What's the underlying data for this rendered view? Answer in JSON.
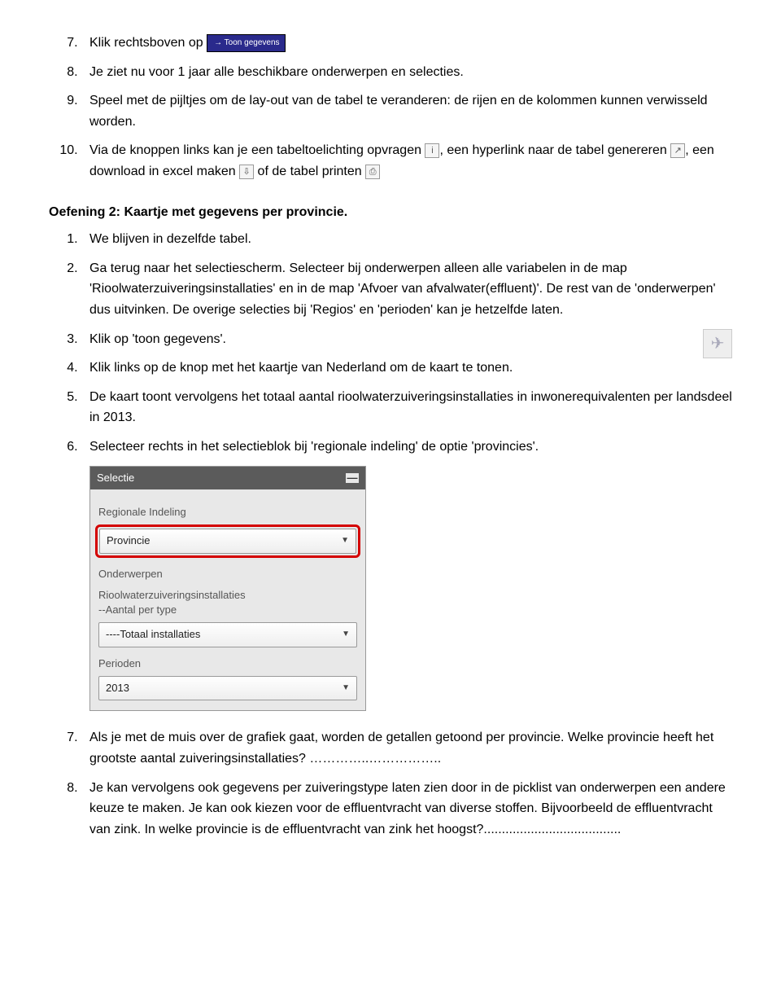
{
  "items_a": {
    "i7_pre": "Klik rechtsboven op ",
    "i7_btn": "→ Toon gegevens",
    "i8": "Je ziet nu voor 1 jaar alle beschikbare onderwerpen en selecties.",
    "i9": "Speel met de pijltjes om de lay-out van de tabel te veranderen: de rijen en de kolommen kunnen verwisseld worden.",
    "i10_a": "Via de knoppen links kan je een tabeltoelichting opvragen ",
    "i10_b": ", een hyperlink naar de tabel genereren ",
    "i10_c": ", een download in excel maken ",
    "i10_d": " of de tabel printen "
  },
  "heading": "Oefening 2: Kaartje met gegevens per provincie.",
  "items_b": {
    "i1": "We blijven in dezelfde tabel.",
    "i2": "Ga terug naar het selectiescherm. Selecteer bij onderwerpen alleen alle variabelen in de map 'Rioolwaterzuiveringsinstallaties' en in de map 'Afvoer van afvalwater(effluent)'. De rest van de 'onderwerpen' dus uitvinken. De overige selecties bij 'Regios' en 'perioden' kan je hetzelfde laten.",
    "i3": "Klik op 'toon gegevens'.",
    "i4": "Klik links op de knop met het kaartje van Nederland om de kaart te tonen.",
    "i5": "De kaart toont vervolgens het totaal aantal rioolwaterzuiveringsinstallaties in inwonerequivalenten per landsdeel in 2013.",
    "i6": "Selecteer rechts in het selectieblok bij 'regionale indeling' de optie 'provincies'.",
    "i7": "Als je met de muis over de grafiek gaat, worden de getallen getoond per provincie. Welke provincie heeft het grootste aantal zuiveringsinstallaties? …………..……………..",
    "i8": "Je kan vervolgens ook gegevens per zuiveringstype laten zien door in de picklist van onderwerpen een andere keuze te maken. Je kan ook kiezen voor de effluentvracht van diverse stoffen. Bijvoorbeeld de effluentvracht van zink. In welke provincie is de effluentvracht van zink het hoogst?......................................"
  },
  "panel": {
    "title": "Selectie",
    "label1": "Regionale Indeling",
    "dd1": "Provincie",
    "label2": "Onderwerpen",
    "sub1": "Rioolwaterzuiveringsinstallaties",
    "sub2": "--Aantal per type",
    "dd2": "----Totaal installaties",
    "label3": "Perioden",
    "dd3": "2013"
  },
  "icons": {
    "info": "i",
    "link": "↗",
    "download": "⇩",
    "print": "⎙",
    "map": "✈"
  }
}
